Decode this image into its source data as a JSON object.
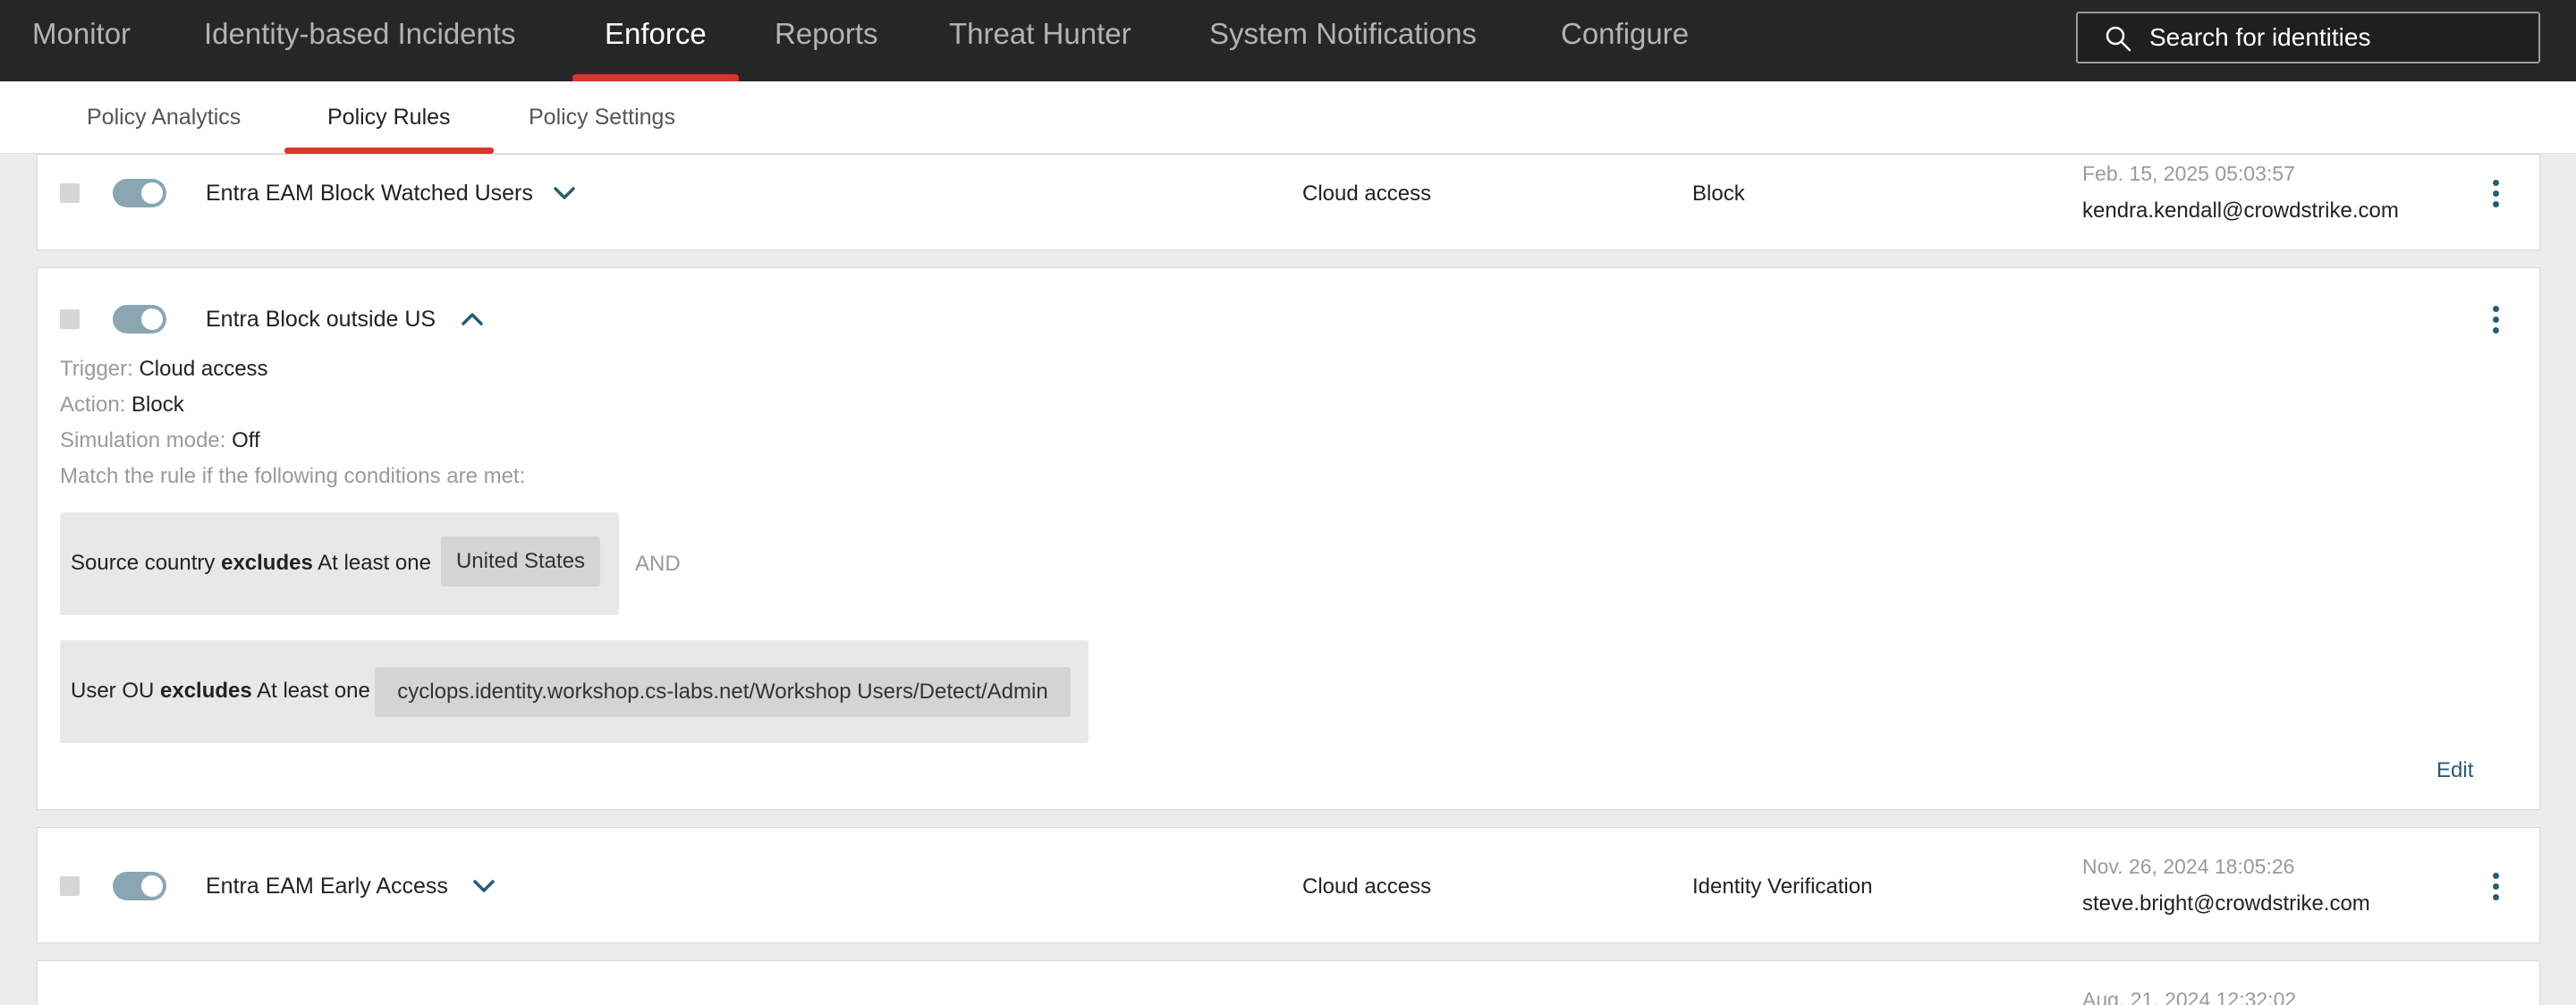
{
  "nav": {
    "tabs": [
      {
        "label": "Monitor"
      },
      {
        "label": "Identity-based Incidents"
      },
      {
        "label": "Enforce"
      },
      {
        "label": "Reports"
      },
      {
        "label": "Threat Hunter"
      },
      {
        "label": "System Notifications"
      },
      {
        "label": "Configure"
      }
    ],
    "active_tab": "Enforce",
    "search": {
      "placeholder": "Search for identities"
    }
  },
  "subnav": {
    "tabs": [
      {
        "label": "Policy Analytics"
      },
      {
        "label": "Policy Rules"
      },
      {
        "label": "Policy Settings"
      }
    ],
    "active_tab": "Policy Rules"
  },
  "rules": [
    {
      "name": "Entra EAM Block Watched Users",
      "enabled": true,
      "trigger": "Cloud access",
      "action": "Block",
      "modified_date": "Feb. 15, 2025 05:03:57",
      "modified_by": "kendra.kendall@crowdstrike.com"
    },
    {
      "name": "Entra Block outside US",
      "enabled": true,
      "expanded": true,
      "details": {
        "trigger_label": "Trigger:",
        "trigger_value": "Cloud access",
        "action_label": "Action:",
        "action_value": "Block",
        "simulation_label": "Simulation mode:",
        "simulation_value": "Off",
        "match_text": "Match the rule if the following conditions are met:",
        "conditions": [
          {
            "field": "Source country",
            "operator": "excludes",
            "quantifier": "At least one",
            "value": "United States"
          },
          {
            "field": "User OU",
            "operator": "excludes",
            "quantifier": "At least one",
            "value": "cyclops.identity.workshop.cs-labs.net/Workshop Users/Detect/Admin"
          }
        ],
        "joiner": "AND",
        "edit_label": "Edit"
      }
    },
    {
      "name": "Entra EAM Early Access",
      "enabled": true,
      "trigger": "Cloud access",
      "action": "Identity Verification",
      "modified_date": "Nov. 26, 2024 18:05:26",
      "modified_by": "steve.bright@crowdstrike.com"
    },
    {
      "modified_date": "Aug. 21, 2024 12:32:02"
    }
  ],
  "colors": {
    "nav_bg": "#262626",
    "accent_red": "#d9352f",
    "link_blue": "#2c5a73",
    "toggle_on": "#8aa6b3"
  }
}
